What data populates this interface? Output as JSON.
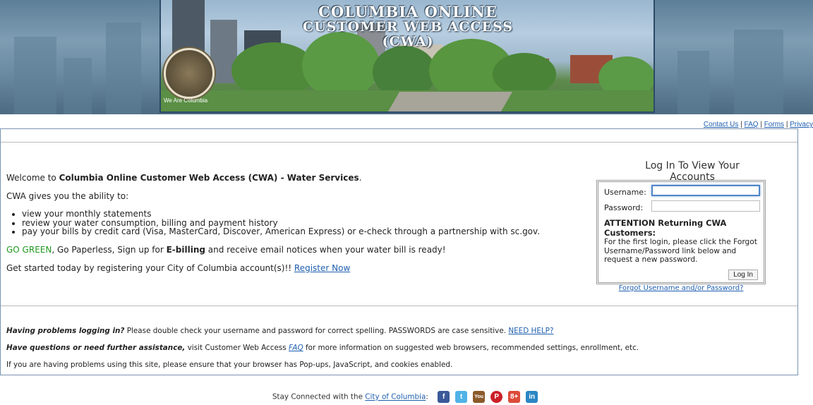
{
  "banner": {
    "title_line1": "COLUMBIA ONLINE",
    "title_line2": "CUSTOMER WEB ACCESS (CWA)",
    "seal_tagline": "We Are Columbia"
  },
  "top_links": {
    "contact": "Contact Us",
    "faq": "FAQ",
    "forms": "Forms",
    "privacy": "Privacy",
    "separator": " | "
  },
  "welcome": {
    "intro_prefix": "Welcome to ",
    "intro_bold": "Columbia Online Customer Web Access (CWA) - Water Services",
    "intro_suffix": ".",
    "ability": "CWA gives you the ability to:",
    "bullets": [
      "view your monthly statements",
      "review your water consumption, billing and payment history",
      "pay your bills by credit card (Visa, MasterCard, Discover, American Express) or e-check through a partnership with sc.gov."
    ],
    "green_prefix": "GO GREEN",
    "green_mid": ", Go Paperless, Sign up for ",
    "green_bold": "E-billing",
    "green_suffix": " and receive email notices when your water bill is ready!",
    "started_text": "Get started today by registering your City of Columbia account(s)!! ",
    "register_link": "Register Now"
  },
  "login": {
    "title": "Log In To View Your Accounts",
    "username_label": "Username:",
    "username_value": "",
    "password_label": "Password:",
    "password_value": "",
    "attention_bold": "ATTENTION Returning CWA Customers:",
    "attention_text": "For the first login, please click the Forgot Username/Password link below and request a new password.",
    "login_button": "Log In",
    "forgot_link": "Forgot Username and/or Password?"
  },
  "help": {
    "problems_bold": "Having problems logging in?",
    "problems_text": " Please double check your username and password for correct spelling. PASSWORDS are case sensitive. ",
    "need_help_link": "NEED HELP?",
    "questions_bold": "Have questions or need further assistance,",
    "questions_text_1": " visit Customer Web Access ",
    "faq_link": "FAQ",
    "questions_text_2": " for more information on suggested web browsers, recommended settings, enrollment, etc.",
    "browser_note": "If you are having problems using this site, please ensure that your browser has Pop-ups, JavaScript, and cookies enabled."
  },
  "footer": {
    "stay_connected": "Stay Connected with the ",
    "city_link": "City of Columbia",
    "colon": ":",
    "social": [
      {
        "name": "facebook-icon",
        "glyph": "f",
        "color": "#3b5998"
      },
      {
        "name": "twitter-icon",
        "glyph": "t",
        "color": "#4fb3e8"
      },
      {
        "name": "youtube-icon",
        "glyph": "You",
        "color": "#8b5a2b"
      },
      {
        "name": "pinterest-icon",
        "glyph": "P",
        "color": "#cb2027"
      },
      {
        "name": "googleplus-icon",
        "glyph": "8+",
        "color": "#dd4b39"
      },
      {
        "name": "linkedin-icon",
        "glyph": "in",
        "color": "#2a86c4"
      }
    ]
  }
}
